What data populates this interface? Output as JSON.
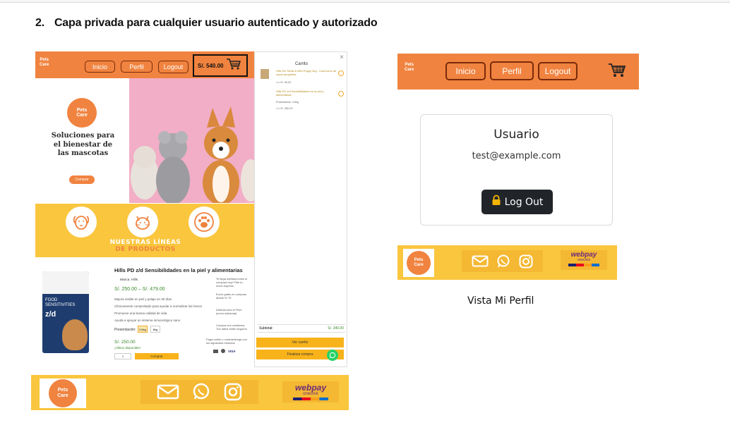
{
  "heading": {
    "number": "2.",
    "text": "Capa privada para cualquier usuario autenticado y autorizado"
  },
  "brand": {
    "logo_line1": "Pets",
    "logo_line2": "Care"
  },
  "left_nav": {
    "inicio": "Inicio",
    "perfil": "Perfil",
    "logout": "Logout",
    "cart_total": "S/. 540.00"
  },
  "hero": {
    "tagline": "Soluciones para el bienestar de las mascotas",
    "button": "Comprar"
  },
  "lineas": {
    "line1": "NUESTRAS LÍNEAS",
    "line2": "DE PRODUCTOS"
  },
  "product": {
    "title": "Hills PD z/d Sensibilidades en la piel y alimentarias",
    "brand": "Marca: Hills",
    "price_range": "S/. 250.00 – S/. 479.00",
    "bullets": [
      "Mejora visible en piel y pelaje en 30 días",
      "Clínicamente comprobado para ayudar a normalizar las heces",
      "Promueve una buena calidad de vida",
      "Ayuda a apoyar un sistema inmunológico sano"
    ],
    "presentation_label": "Presentación:",
    "sizes": [
      "3.6kg",
      "8kg"
    ],
    "price": "S/. 250.00",
    "stock": "¡Último disponible!",
    "qty": "1",
    "buy": "Comprar",
    "bag_line1": "FOOD",
    "bag_line2": "SENSITIVITIES",
    "bag_code": "z/d",
    "features": [
      "Te llega mañana lunes si compras hoy! Pide tu envío express",
      "Envío gratis en compras desde S/ 79",
      "Disfruta todo el Perú (envío adicional)",
      "Compra con confianza. Tus datos están seguros"
    ],
    "payment_note": "Paga online o contraentrega con los siguientes métodos",
    "visa": "VISA"
  },
  "cart": {
    "title": "Carrito",
    "item1_name": "Hills SD Small & Mini Puppy 2kg - Cachorros de razas pequeñas",
    "item1_price": "1 x S/. 90.00",
    "item2_name": "Hills PD z/d Sensibilidades en la piel y alimentarias",
    "item2_detail": "Presentación: 3.6kg",
    "item2_price": "1 x S/. 250.00",
    "subtotal_label": "Subtotal:",
    "subtotal_value": "S/. 340.00",
    "view_button": "Ver carrito",
    "checkout_button": "Finalizar compra"
  },
  "webpay": {
    "word": "webpay",
    "sub": "oneclick"
  },
  "right_nav": {
    "inicio": "Inicio",
    "perfil": "Perfil",
    "logout": "Logout"
  },
  "profile": {
    "title": "Usuario",
    "email": "test@example.com",
    "logout_button": "Log Out"
  },
  "caption": "Vista Mi Perfil",
  "colors": {
    "orange": "#f0833f",
    "yellow": "#f9c63e",
    "dark_button": "#212529"
  }
}
